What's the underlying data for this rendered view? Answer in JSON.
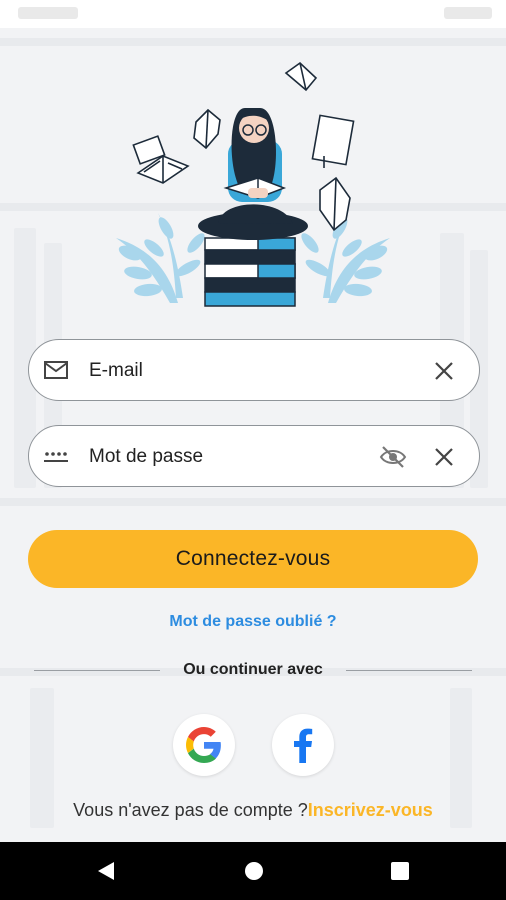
{
  "login": {
    "email_placeholder": "E-mail",
    "password_placeholder": "Mot de passe",
    "submit_label": "Connectez-vous",
    "forgot_label": "Mot de passe oublié ?",
    "or_label": "Ou continuer avec",
    "signup_prompt": "Vous n'avez pas de compte ?",
    "signup_link": "Inscrivez-vous"
  },
  "icons": {
    "email": "mail-icon",
    "password": "password-dots-icon",
    "clear": "close-icon",
    "visibility": "eye-off-icon",
    "google": "google-icon",
    "facebook": "facebook-icon",
    "nav_back": "triangle-back-icon",
    "nav_home": "circle-home-icon",
    "nav_recent": "square-recent-icon"
  },
  "colors": {
    "accent": "#fbb627",
    "link": "#2d8ce0",
    "illustration_blue": "#3aa7d8",
    "leaf_blue": "#a9d6ec"
  }
}
